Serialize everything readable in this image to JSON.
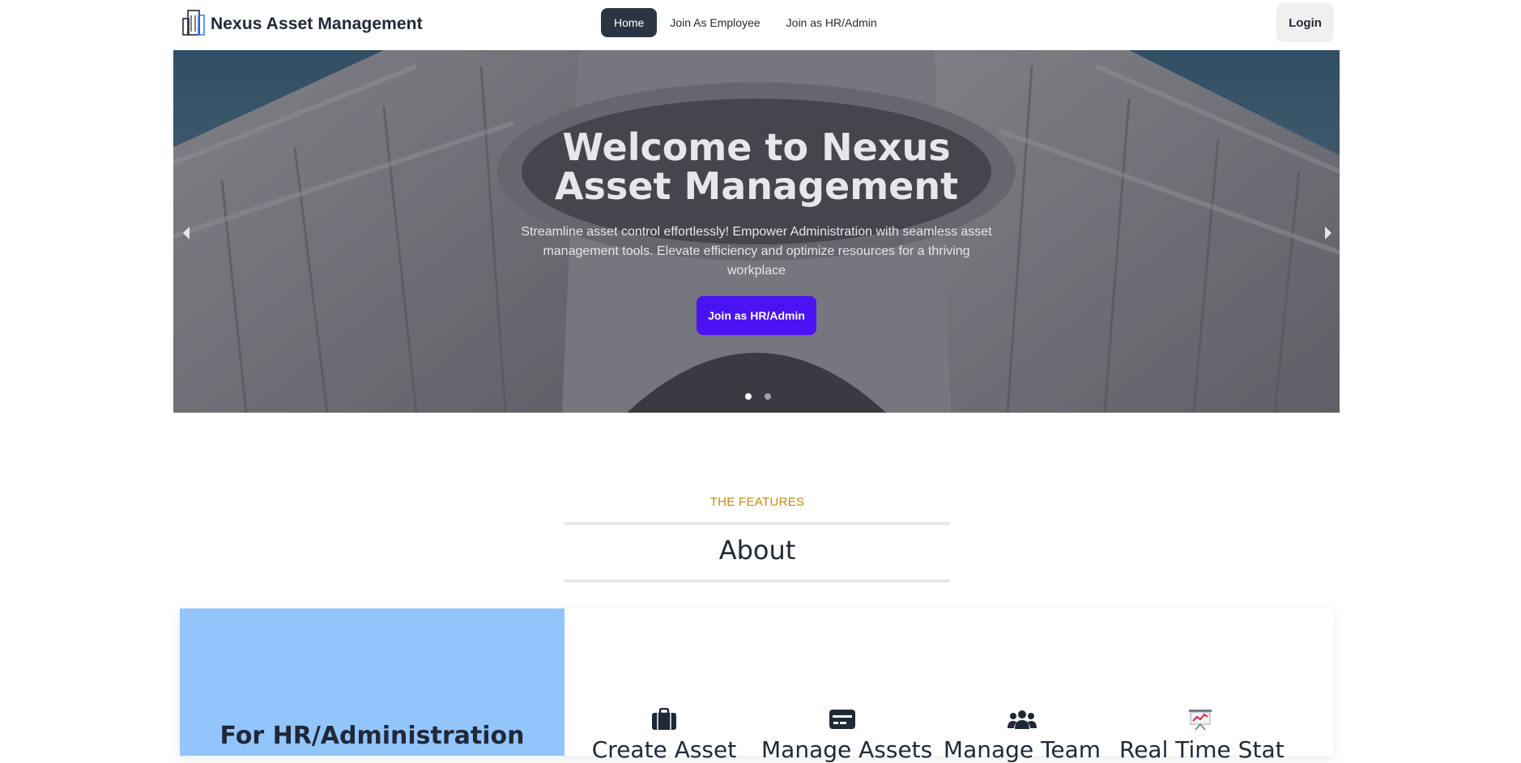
{
  "navbar": {
    "brand": "Nexus Asset Management",
    "brand_icon": "buildings-icon",
    "menu": [
      {
        "label": "Home",
        "active": true
      },
      {
        "label": "Join As Employee",
        "active": false
      },
      {
        "label": "Join as HR/Admin",
        "active": false
      }
    ],
    "login_label": "Login"
  },
  "hero": {
    "title": "Welcome to Nexus Asset Management",
    "subtitle": "Streamline asset control effortlessly! Empower Administration with seamless asset management tools. Elevate efficiency and optimize resources for a thriving workplace",
    "cta_label": "Join as HR/Admin",
    "cta_color": "#4a12f5",
    "slides_count": 2,
    "active_slide": 1
  },
  "features": {
    "eyebrow": "THE FEATURES",
    "title": "About",
    "side_title": "For HR/Administration",
    "side_color": "#93c5fd",
    "items": [
      {
        "icon": "briefcase-icon",
        "label": "Create Asset"
      },
      {
        "icon": "card-icon",
        "label": "Manage Assets"
      },
      {
        "icon": "users-icon",
        "label": "Manage Team"
      },
      {
        "icon": "chart-presentation-icon",
        "label": "Real Time Stat"
      }
    ]
  }
}
